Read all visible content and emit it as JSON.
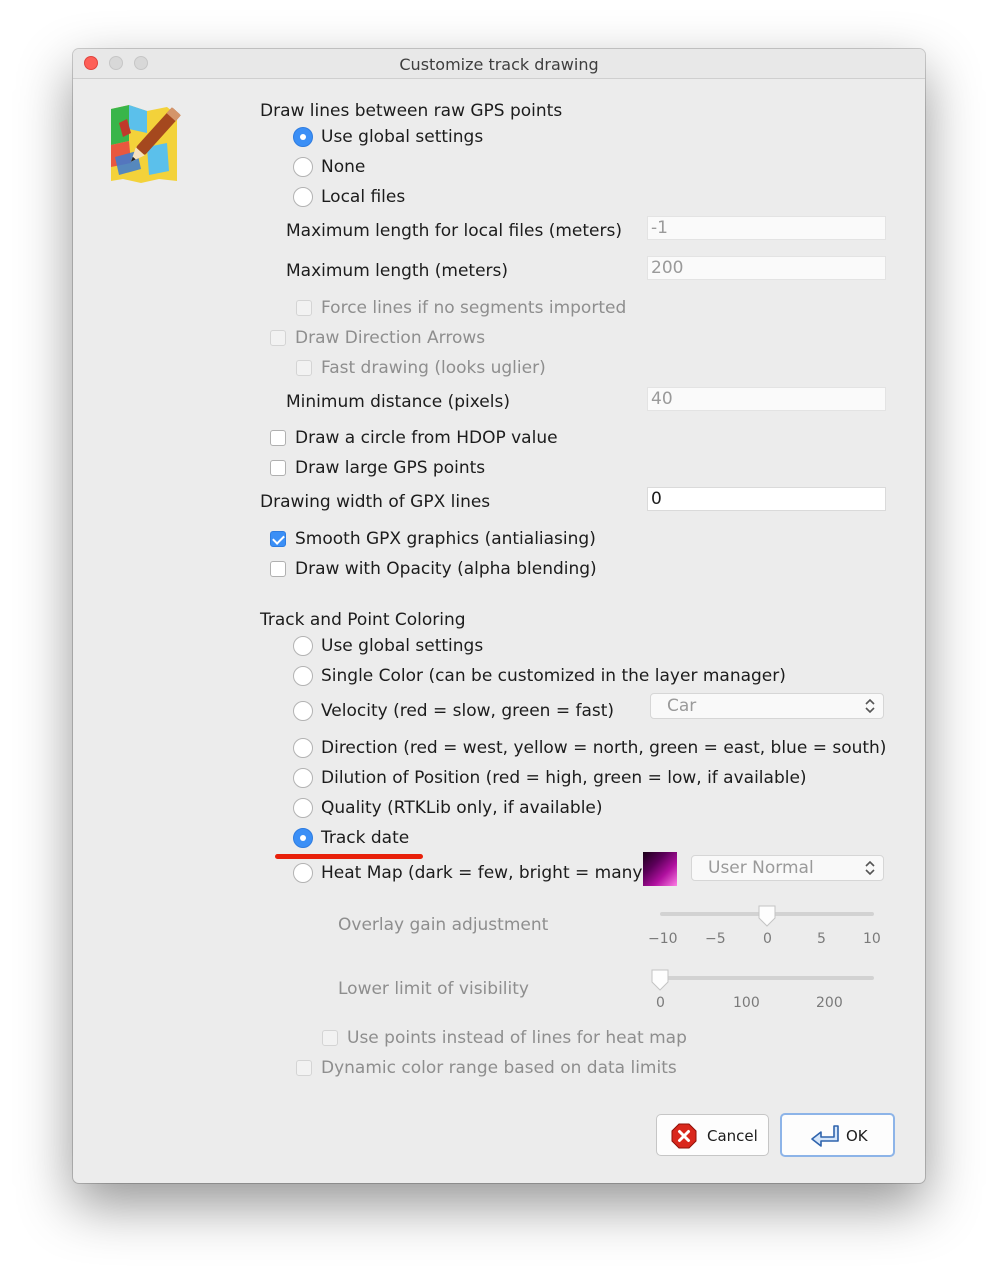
{
  "window": {
    "title": "Customize track drawing"
  },
  "lines_section": {
    "heading": "Draw lines between raw GPS points",
    "radios": [
      {
        "label": "Use global settings",
        "selected": true
      },
      {
        "label": "None",
        "selected": false
      },
      {
        "label": "Local files",
        "selected": false
      }
    ],
    "max_local_label": "Maximum length for local files (meters)",
    "max_local_value": "-1",
    "max_length_label": "Maximum length (meters)",
    "max_length_value": "200",
    "force_lines_label": "Force lines if no segments imported",
    "direction_arrows_label": "Draw Direction Arrows",
    "fast_drawing_label": "Fast drawing (looks uglier)",
    "min_distance_label": "Minimum distance (pixels)",
    "min_distance_value": "40",
    "hdop_label": "Draw a circle from HDOP value",
    "large_points_label": "Draw large GPS points",
    "width_label": "Drawing width of GPX lines",
    "width_value": "0",
    "smooth_label": "Smooth GPX graphics (antialiasing)",
    "smooth_checked": true,
    "opacity_label": "Draw with Opacity (alpha blending)"
  },
  "coloring_section": {
    "heading": "Track and Point Coloring",
    "radios": [
      {
        "label": "Use global settings",
        "selected": false
      },
      {
        "label": "Single Color (can be customized in the layer manager)",
        "selected": false
      },
      {
        "label": "Velocity (red = slow, green = fast)",
        "selected": false
      },
      {
        "label": "Direction (red = west, yellow = north, green = east, blue = south)",
        "selected": false
      },
      {
        "label": "Dilution of Position (red = high, green = low, if available)",
        "selected": false
      },
      {
        "label": "Quality (RTKLib only, if available)",
        "selected": false
      },
      {
        "label": "Track date",
        "selected": true
      },
      {
        "label": "Heat Map (dark = few, bright = many)",
        "selected": false
      }
    ],
    "velocity_combo": "Car",
    "heatmap_combo": "User Normal",
    "overlay_gain_label": "Overlay gain adjustment",
    "overlay_gain_ticks": [
      "−10",
      "−5",
      "0",
      "5",
      "10"
    ],
    "overlay_gain_value": 0,
    "lower_limit_label": "Lower limit of visibility",
    "lower_limit_ticks": [
      "0",
      "100",
      "200"
    ],
    "lower_limit_value": 0,
    "use_points_label": "Use points instead of lines for heat map",
    "dynamic_range_label": "Dynamic color range based on data limits"
  },
  "buttons": {
    "cancel": "Cancel",
    "ok": "OK"
  },
  "colors": {
    "accent": "#3b8ff6",
    "annotation": "#e8200a"
  }
}
